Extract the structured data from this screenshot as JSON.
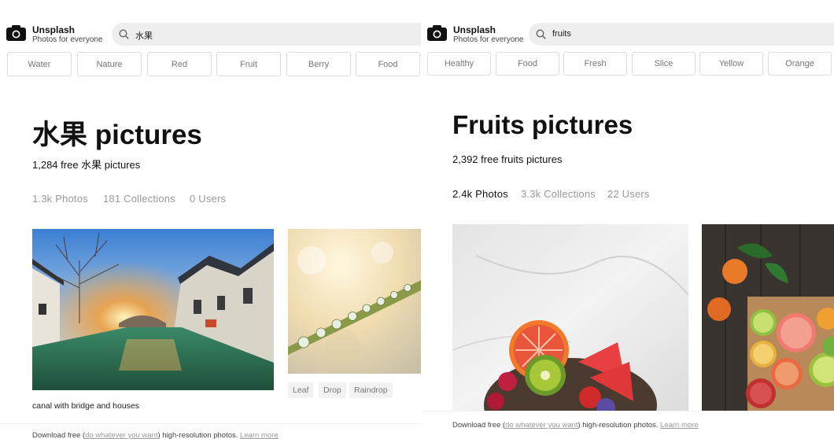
{
  "brand": {
    "name": "Unsplash",
    "tagline": "Photos for everyone"
  },
  "left": {
    "search_value": "水果",
    "tags": [
      "Water",
      "Nature",
      "Red",
      "Fruit",
      "Berry",
      "Food"
    ],
    "title": "水果 pictures",
    "subtitle": "1,284 free 水果 pictures",
    "stats": {
      "photos": "1.3k Photos",
      "collections": "181 Collections",
      "users": "0 Users"
    },
    "photo1_caption": "canal with bridge and houses",
    "photo2_tags": [
      "Leaf",
      "Drop",
      "Raindrop"
    ],
    "footer": {
      "prefix": "Download free (",
      "link": "do whatever you want",
      "suffix": ") high-resolution photos.",
      "learn": "Learn more"
    }
  },
  "right": {
    "search_value": "fruits",
    "tags": [
      "Healthy",
      "Food",
      "Fresh",
      "Slice",
      "Yellow",
      "Orange"
    ],
    "title": "Fruits pictures",
    "subtitle": "2,392 free fruits pictures",
    "stats": {
      "photos": "2.4k Photos",
      "collections": "3.3k Collections",
      "users": "22 Users"
    },
    "active_stat": "photos",
    "footer": {
      "prefix": "Download free (",
      "link": "do whatever you want",
      "suffix": ") high-resolution photos.",
      "learn": "Learn more"
    }
  },
  "icons": [
    "camera-icon",
    "search-icon"
  ]
}
